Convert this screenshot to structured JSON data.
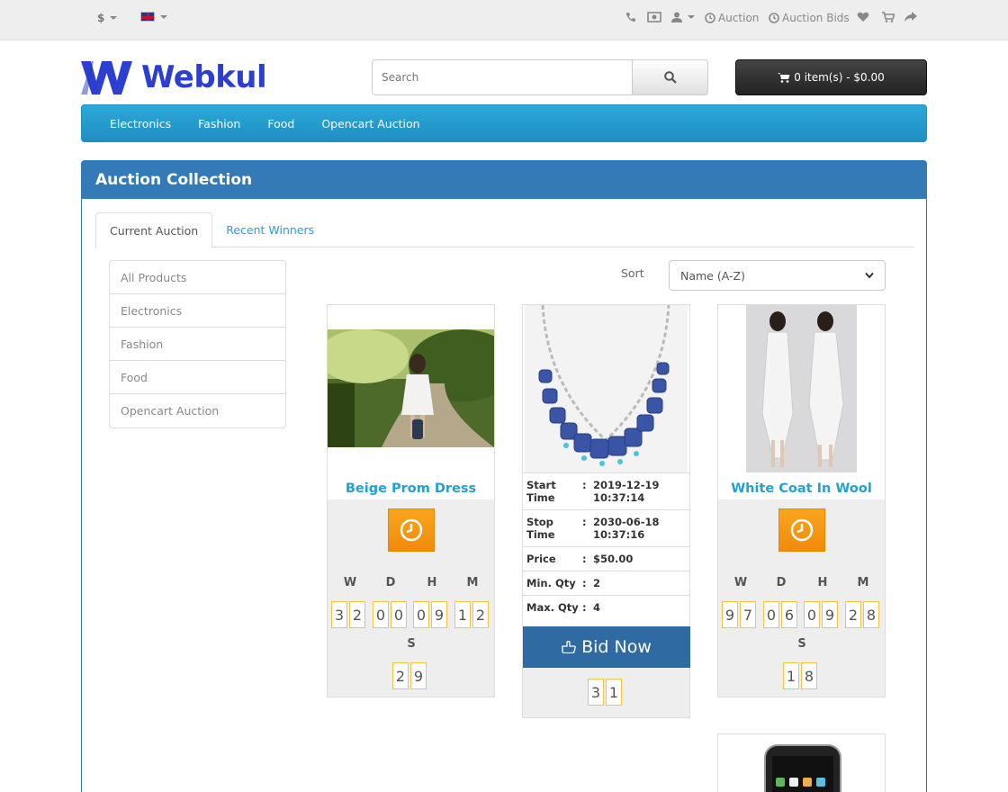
{
  "topbar": {
    "currency": "$",
    "links": [
      "Auction",
      "Auction Bids"
    ]
  },
  "header": {
    "logo_text": "Webkul",
    "search_placeholder": "Search",
    "cart_label": "0 item(s) - $0.00"
  },
  "nav": [
    "Electronics",
    "Fashion",
    "Food",
    "Opencart Auction"
  ],
  "panel": {
    "title": "Auction Collection",
    "tabs": [
      "Current Auction",
      "Recent Winners"
    ],
    "categories": [
      "All Products",
      "Electronics",
      "Fashion",
      "Food",
      "Opencart Auction"
    ],
    "sort_label": "Sort",
    "sort_value": "Name (A-Z)"
  },
  "timer_labels": {
    "w": "W",
    "d": "D",
    "h": "H",
    "m": "M",
    "s": "S"
  },
  "products": {
    "p1": {
      "name": "Beige Prom Dress",
      "w": [
        "3",
        "2"
      ],
      "d": [
        "0",
        "0"
      ],
      "h": [
        "0",
        "9"
      ],
      "m": [
        "1",
        "2"
      ],
      "s": [
        "2",
        "9"
      ]
    },
    "p2": {
      "start_label": "Start Time",
      "start_date": "2019-12-19",
      "start_time": "10:37:14",
      "stop_label": "Stop Time",
      "stop_date": "2030-06-18",
      "stop_time": "10:37:16",
      "price_label": "Price",
      "price": "$50.00",
      "min_label": "Min. Qty",
      "min": "2",
      "max_label": "Max. Qty",
      "max": "4",
      "bid_label": "Bid Now",
      "s": [
        "3",
        "1"
      ]
    },
    "p3": {
      "name": "White Coat In Wool",
      "w": [
        "9",
        "7"
      ],
      "d": [
        "0",
        "6"
      ],
      "h": [
        "0",
        "9"
      ],
      "m": [
        "2",
        "8"
      ],
      "s": [
        "1",
        "8"
      ]
    }
  }
}
